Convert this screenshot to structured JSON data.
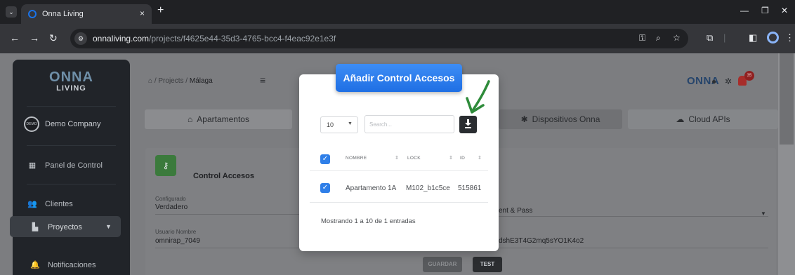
{
  "browser": {
    "tab_title": "Onna Living",
    "tab_close": "×",
    "new_tab": "+",
    "url_host": "onnaliving.com",
    "url_path": "/projects/f4625e44-35d3-4765-bcc4-f4eac92e1e3f"
  },
  "sidebar": {
    "logo_top": "ONNA",
    "logo_bottom": "LIVING",
    "company": "Demo Company",
    "company_avatar": "DEMO",
    "items": [
      {
        "label": "Panel de Control",
        "icon": "dashboard-icon"
      },
      {
        "label": "Clientes",
        "icon": "users-icon"
      },
      {
        "label": "Proyectos",
        "icon": "building-icon"
      },
      {
        "label": "Notificaciones",
        "icon": "bell-icon"
      }
    ]
  },
  "header": {
    "breadcrumb_projects": "Projects",
    "breadcrumb_separator": "/",
    "breadcrumb_current": "Málaga",
    "logo": "ONNA",
    "notif_count": "35"
  },
  "tabs": {
    "apartamentos": "Apartamentos",
    "dispositivos": "Dispositivos Onna",
    "cloud": "Cloud APIs"
  },
  "card": {
    "title": "Control Accesos",
    "configurado_label": "Configurado",
    "configurado_value": "Verdadero",
    "usuario_label": "Usuario Nombre",
    "usuario_value": "omnirap_7049",
    "auth_partial": "ent & Pass",
    "token_partial": "dshE3T4G2mq5sYO1K4o2",
    "guardar": "GUARDAR",
    "test": "TEST"
  },
  "modal": {
    "title": "Añadir Control Accesos",
    "length_value": "10",
    "search_placeholder": "Search...",
    "columns": {
      "nombre": "NOMBRE",
      "lock": "LOCK",
      "id": "ID"
    },
    "rows": [
      {
        "nombre": "Apartamento 1A",
        "lock": "M102_b1c5ce",
        "id": "515861"
      }
    ],
    "info": "Mostrando 1 a 10 de 1 entradas"
  },
  "colors": {
    "modal_header": "#2a7af0",
    "checkbox": "#2f7fe8",
    "annotation_arrow": "#2e8b3a"
  }
}
